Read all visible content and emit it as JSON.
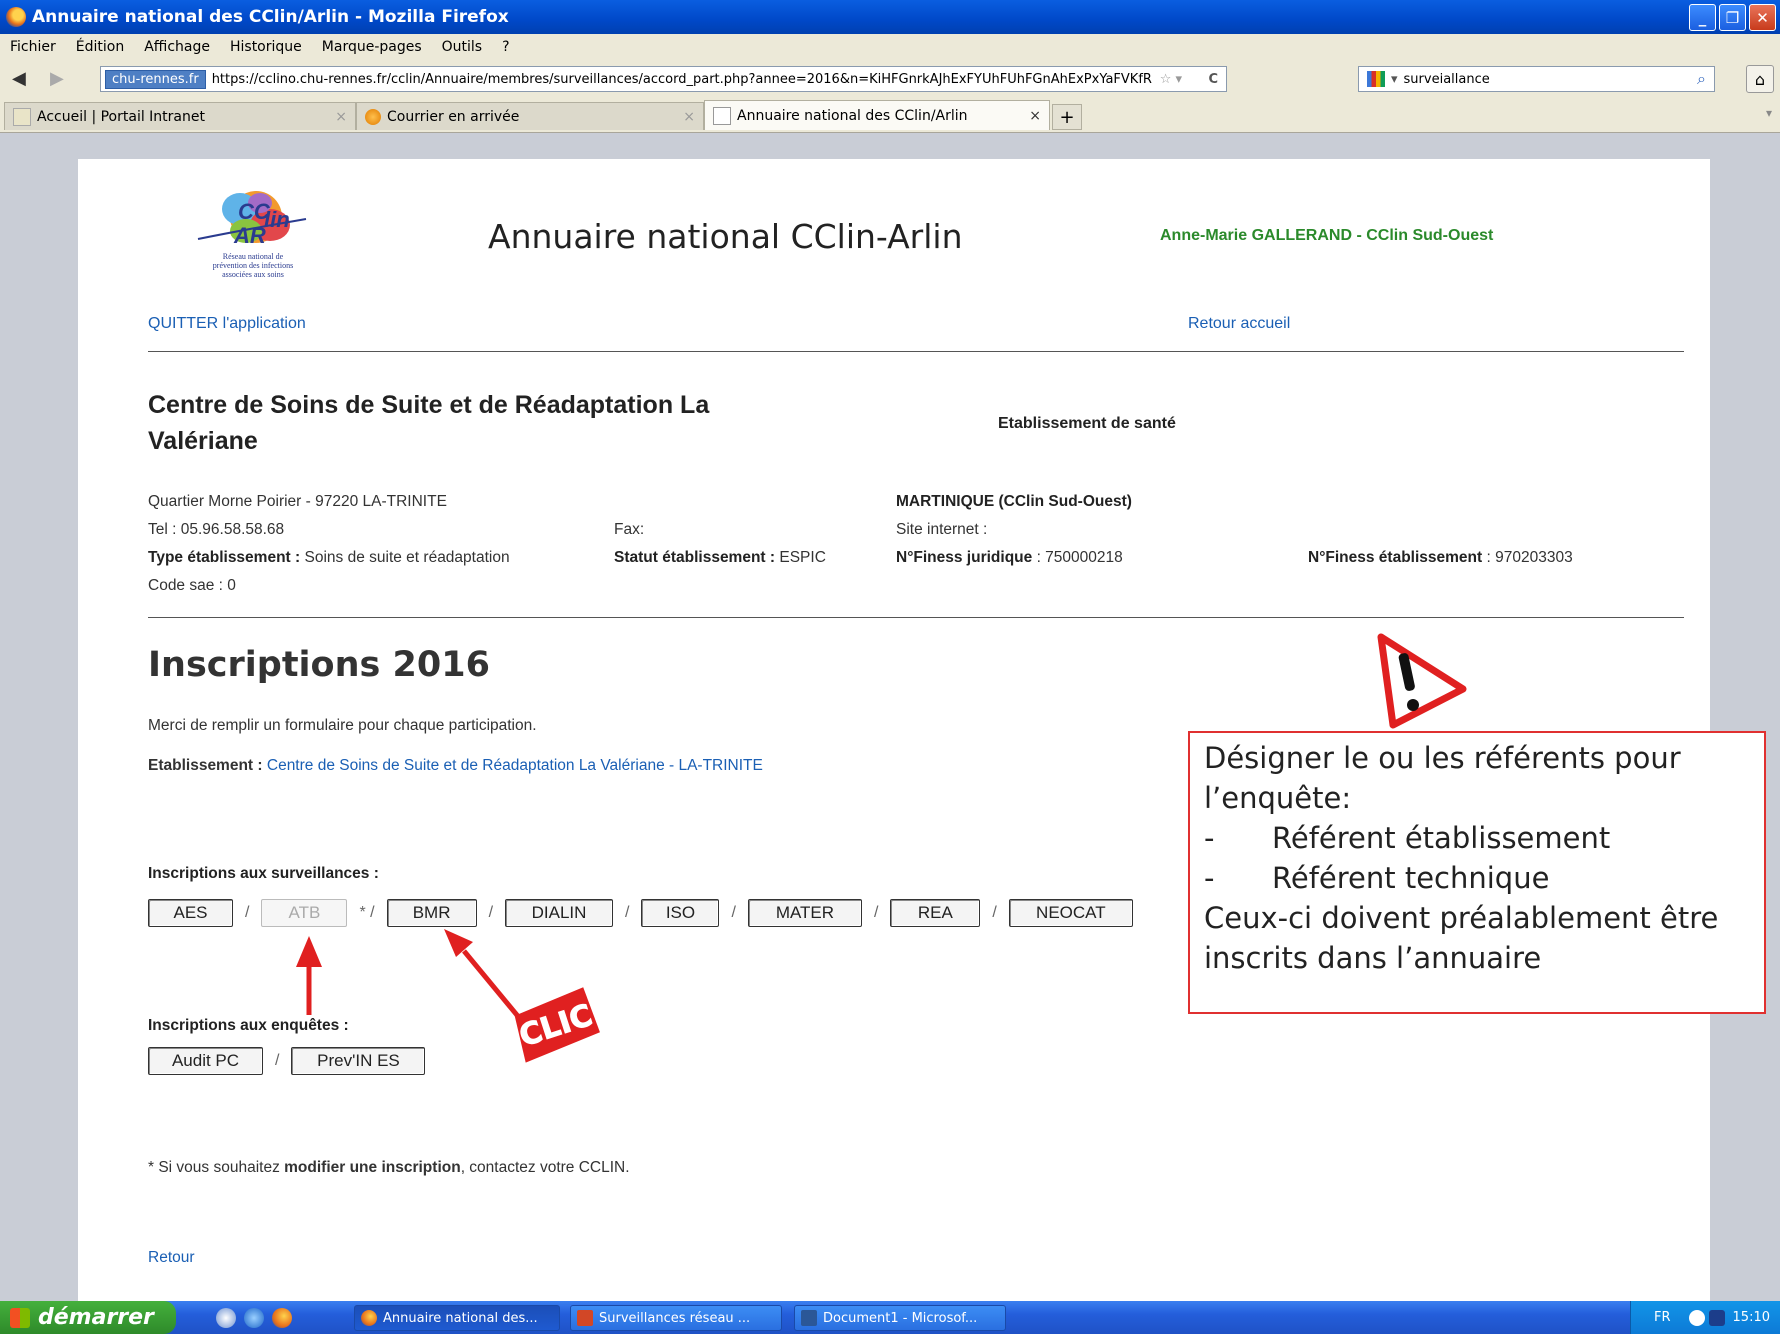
{
  "window": {
    "title": "Annuaire national des CClin/Arlin - Mozilla Firefox",
    "controls": [
      "minimize",
      "maximize",
      "close"
    ]
  },
  "menu": [
    "Fichier",
    "Édition",
    "Affichage",
    "Historique",
    "Marque-pages",
    "Outils",
    "?"
  ],
  "navbar": {
    "site_badge": "chu-rennes.fr",
    "url": "https://cclino.chu-rennes.fr/cclin/Annuaire/membres/surveillances/accord_part.php?annee=2016&n=KiHFGnrkAJhExFYUhFUhFGnAhExPxYaFVKfR",
    "search_value": "surveiallance"
  },
  "tabs": [
    {
      "label": "Accueil | Portail Intranet",
      "active": false
    },
    {
      "label": "Courrier en arrivée",
      "active": false
    },
    {
      "label": "Annuaire national des CClin/Arlin",
      "active": true
    }
  ],
  "header": {
    "logo_tagline": [
      "Réseau national de",
      "prévention des infections",
      "associées aux soins"
    ],
    "site_title": "Annuaire national CClin-Arlin",
    "user": "Anne-Marie GALLERAND - CClin Sud-Ouest",
    "quit_link": "QUITTER l'application",
    "home_link": "Retour accueil"
  },
  "establishment": {
    "name": "Centre de Soins de Suite et de Réadaptation La Valériane",
    "category": "Etablissement de santé",
    "address": "Quartier Morne Poirier - 97220 LA-TRINITE",
    "region": "MARTINIQUE (CClin Sud-Ouest)",
    "tel": "Tel : 05.96.58.58.68",
    "fax": "Fax:",
    "website": "Site internet :",
    "type_label": "Type établissement :",
    "type_value": "Soins de suite et réadaptation",
    "statut_label": "Statut établissement :",
    "statut_value": "ESPIC",
    "finess_jur_label": "N°Finess juridique",
    "finess_jur_value": ": 750000218",
    "finess_etab_label": "N°Finess établissement",
    "finess_etab_value": ": 970203303",
    "code_sae": "Code sae : 0"
  },
  "inscriptions": {
    "title": "Inscriptions 2016",
    "intro": "Merci de remplir un formulaire pour chaque participation.",
    "etab_label": "Etablissement :",
    "etab_link": "Centre de Soins de Suite et de Réadaptation La Valériane - LA-TRINITE",
    "surv_label": "Inscriptions aux surveillances :",
    "surv_buttons": [
      "AES",
      "ATB",
      "BMR",
      "DIALIN",
      "ISO",
      "MATER",
      "REA",
      "NEOCAT"
    ],
    "enq_label": "Inscriptions aux enquêtes :",
    "enq_buttons": [
      "Audit PC",
      "Prev'IN ES"
    ],
    "note_pre": "* Si vous souhaitez ",
    "note_bold": "modifier une inscription",
    "note_post": ", contactez votre CCLIN.",
    "back": "Retour"
  },
  "annotation": {
    "stamp": "CLIC",
    "callout_lines": [
      "Désigner le ou les référents pour",
      "l’enquête:",
      "Référent établissement",
      "Référent technique",
      "Ceux-ci doivent préalablement être",
      "inscrits dans l’annuaire"
    ],
    "color": "#e02020"
  },
  "taskbar": {
    "start": "démarrer",
    "tasks": [
      "Annuaire national des...",
      "Surveillances réseau ...",
      "Document1 - Microsof..."
    ],
    "lang": "FR",
    "time": "15:10"
  }
}
